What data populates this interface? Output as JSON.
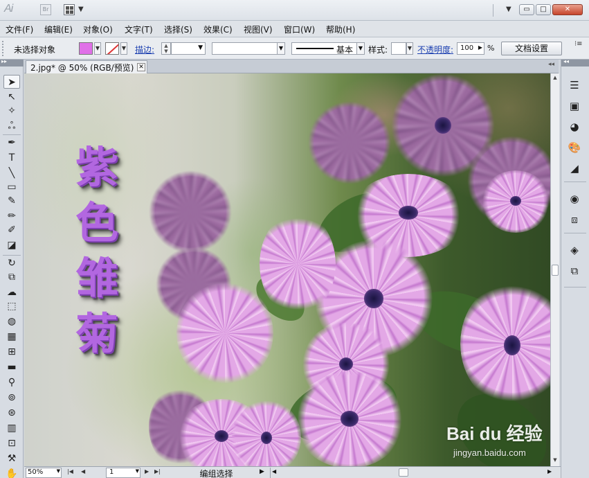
{
  "titlebar": {
    "logo_text": "Ai",
    "bridge_label": "Br",
    "min_glyph": "▭",
    "max_glyph": "□",
    "close_glyph": "✕",
    "dropdown_glyph": "▼"
  },
  "menu": [
    "文件(F)",
    "编辑(E)",
    "对象(O)",
    "文字(T)",
    "选择(S)",
    "效果(C)",
    "视图(V)",
    "窗口(W)",
    "帮助(H)"
  ],
  "control": {
    "no_selection": "未选择对象",
    "stroke_label": "描边:",
    "stroke_weight": "",
    "brush_label": "基本",
    "style_label": "样式:",
    "opacity_label": "不透明度:",
    "opacity_value": "100",
    "percent": "%",
    "doc_setup": "文档设置",
    "fill_color": "#e070e8"
  },
  "document": {
    "tab_title": "2.jpg* @ 50% (RGB/预览)",
    "tab_close": "✕",
    "artwork_text": "紫色雏菊",
    "artwork_color": "#b267e0"
  },
  "watermark": {
    "brand": "Bai du 经验",
    "url": "jingyan.baidu.com"
  },
  "status": {
    "zoom": "50%",
    "page": "1",
    "info": "编组选择"
  },
  "tools": [
    {
      "name": "selection-tool-icon",
      "glyph": "➤"
    },
    {
      "name": "direct-selection-tool-icon",
      "glyph": "↖"
    },
    {
      "name": "magic-wand-tool-icon",
      "glyph": "✧"
    },
    {
      "name": "lasso-tool-icon",
      "glyph": "ஃ"
    },
    {
      "name": "pen-tool-icon",
      "glyph": "✒"
    },
    {
      "name": "type-tool-icon",
      "glyph": "T"
    },
    {
      "name": "line-tool-icon",
      "glyph": "╲"
    },
    {
      "name": "rectangle-tool-icon",
      "glyph": "▭"
    },
    {
      "name": "paintbrush-tool-icon",
      "glyph": "✎"
    },
    {
      "name": "pencil-tool-icon",
      "glyph": "✏"
    },
    {
      "name": "blob-brush-tool-icon",
      "glyph": "✐"
    },
    {
      "name": "eraser-tool-icon",
      "glyph": "◪"
    },
    {
      "name": "rotate-tool-icon",
      "glyph": "↻"
    },
    {
      "name": "scale-tool-icon",
      "glyph": "⧉"
    },
    {
      "name": "warp-tool-icon",
      "glyph": "☁"
    },
    {
      "name": "free-transform-tool-icon",
      "glyph": "⬚"
    },
    {
      "name": "shape-builder-tool-icon",
      "glyph": "◍"
    },
    {
      "name": "perspective-grid-tool-icon",
      "glyph": "▦"
    },
    {
      "name": "mesh-tool-icon",
      "glyph": "⊞"
    },
    {
      "name": "gradient-tool-icon",
      "glyph": "▬"
    },
    {
      "name": "eyedropper-tool-icon",
      "glyph": "⚲"
    },
    {
      "name": "blend-tool-icon",
      "glyph": "⊚"
    },
    {
      "name": "symbol-sprayer-tool-icon",
      "glyph": "⊛"
    },
    {
      "name": "column-graph-tool-icon",
      "glyph": "▥"
    },
    {
      "name": "artboard-tool-icon",
      "glyph": "⊡"
    },
    {
      "name": "slice-tool-icon",
      "glyph": "⚒"
    },
    {
      "name": "hand-tool-icon",
      "glyph": "✋"
    }
  ],
  "panels": [
    {
      "name": "stroke-panel-icon",
      "glyph": "☰"
    },
    {
      "name": "gradient-panel-icon",
      "glyph": "▣"
    },
    {
      "name": "transparency-panel-icon",
      "glyph": "◕"
    },
    {
      "name": "color-panel-icon",
      "glyph": "🎨"
    },
    {
      "name": "color-guide-panel-icon",
      "glyph": "◢"
    },
    {
      "name": "appearance-panel-icon",
      "glyph": "◉"
    },
    {
      "name": "graphic-styles-panel-icon",
      "glyph": "⧈"
    },
    {
      "name": "layers-panel-icon",
      "glyph": "◈"
    },
    {
      "name": "artboards-panel-icon",
      "glyph": "⧉"
    }
  ]
}
